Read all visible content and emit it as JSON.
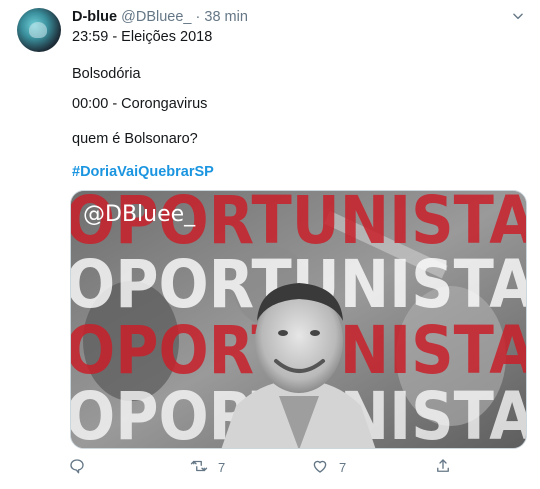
{
  "tweet": {
    "name": "D-blue",
    "handle": "@DBluee_",
    "separator": "·",
    "time": "38 min",
    "lines": [
      "23:59 - Eleições 2018",
      "Bolsodória",
      "00:00 - Corongavirus",
      "quem é Bolsonaro?"
    ],
    "hashtag": "#DoriaVaiQuebrarSP"
  },
  "media": {
    "watermark": "@DBluee_",
    "word": "OPORTUNISTA",
    "word_partial": "OPORTUNISTA"
  },
  "actions": {
    "reply_count": "",
    "retweet_count": "7",
    "like_count": "7",
    "share_count": ""
  },
  "colors": {
    "red": "#c8202a",
    "white_text": "#ffffff",
    "link": "#1b95e0",
    "muted": "#657786"
  }
}
